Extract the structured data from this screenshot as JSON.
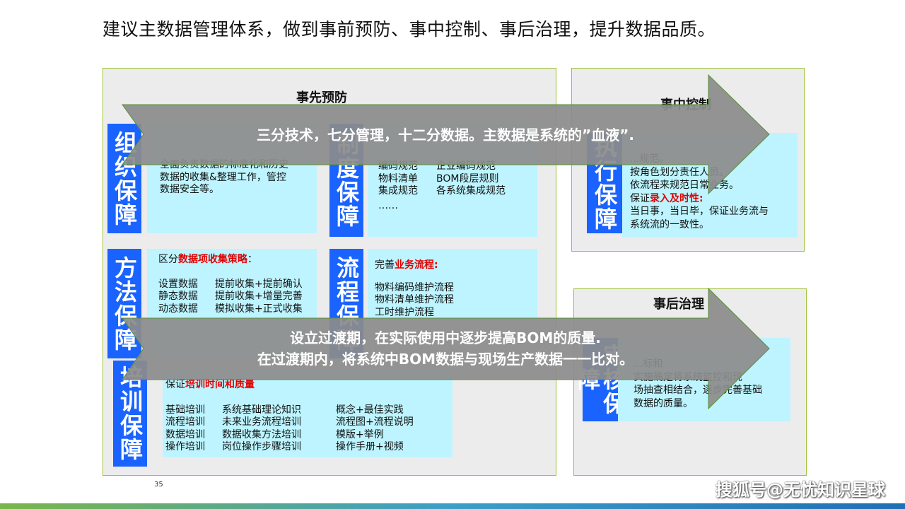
{
  "headline": "建议主数据管理体系，做到事前预防、事中控制、事后治理，提升数据品质。",
  "panels": {
    "prevent": {
      "title": "事先预防"
    },
    "control": {
      "title": "事中控制"
    },
    "govern": {
      "title": "事后治理"
    }
  },
  "blocks": {
    "org": {
      "label": "组织保障",
      "lines": [
        "全面负责数据的标准化和历史",
        "数据的收集&整理工作，管控",
        "数据安全等。"
      ]
    },
    "system": {
      "label": "制度保障",
      "rows": [
        [
          "编码规范",
          "企业编码规范"
        ],
        [
          "物料清单",
          "BOM段层规则"
        ],
        [
          "集成规范",
          "各系统集成规范"
        ]
      ],
      "ellipsis": "……"
    },
    "method": {
      "label": "方法保障",
      "intro_prefix": "区分",
      "intro_highlight": "数据项收集策略",
      "intro_suffix": "：",
      "rows": [
        [
          "设置数据",
          "提前收集+提前确认"
        ],
        [
          "静态数据",
          "提前收集+增量完善"
        ],
        [
          "动态数据",
          "模拟收集+正式收集"
        ]
      ]
    },
    "process": {
      "label": "流程保障",
      "intro_prefix": "完善",
      "intro_highlight": "业务流程:",
      "lines": [
        "物料编码维护流程",
        "物料清单维护流程",
        "工时维护流程"
      ]
    },
    "training": {
      "label": "培训保障",
      "intro_prefix": "保证",
      "intro_highlight": "培训时间和质量",
      "rows": [
        [
          "基础培训",
          "系统基础理论知识",
          "概念+最佳实践"
        ],
        [
          "流程培训",
          "未来业务流程培训",
          "流程图+流程说明"
        ],
        [
          "数据培训",
          "数据收集方法培训",
          "模版+举例"
        ],
        [
          "操作培训",
          "岗位操作步骤培训",
          "操作手册+视频"
        ]
      ]
    },
    "execute": {
      "label": "执行保障",
      "lines": [
        "...规范。",
        "按角色划分责任人员。",
        "依流程来规范日常业务。"
      ],
      "highlight_prefix": "保证",
      "highlight": "录入及时性:",
      "tail": [
        "当日事，当日毕，保证业务流与",
        "系统流的一致性。"
      ]
    },
    "audit": {
      "label": "审核保障",
      "lines": [
        "...标和",
        "实施确定将系统监控和现",
        "场抽查相结合，逐步完善基础",
        "数据的质量。"
      ]
    }
  },
  "arrows": {
    "top": "三分技术，七分管理，十二分数据。主数据是系统的”血液”.",
    "bottom_line1": "设立过渡期，在实际使用中逐步提高BOM的质量.",
    "bottom_line2": "在过渡期内，将系统中BOM数据与现场生产数据一一比对。"
  },
  "page_number": "35",
  "watermark": "搜狐号@无忧知识星球",
  "colors": {
    "label_blue": "#1a63ff",
    "content_cyan": "#bdf4ff",
    "arrow_gray": "#8c8c8c",
    "panel_border": "#9fc23b",
    "highlight_red": "#e00000"
  }
}
